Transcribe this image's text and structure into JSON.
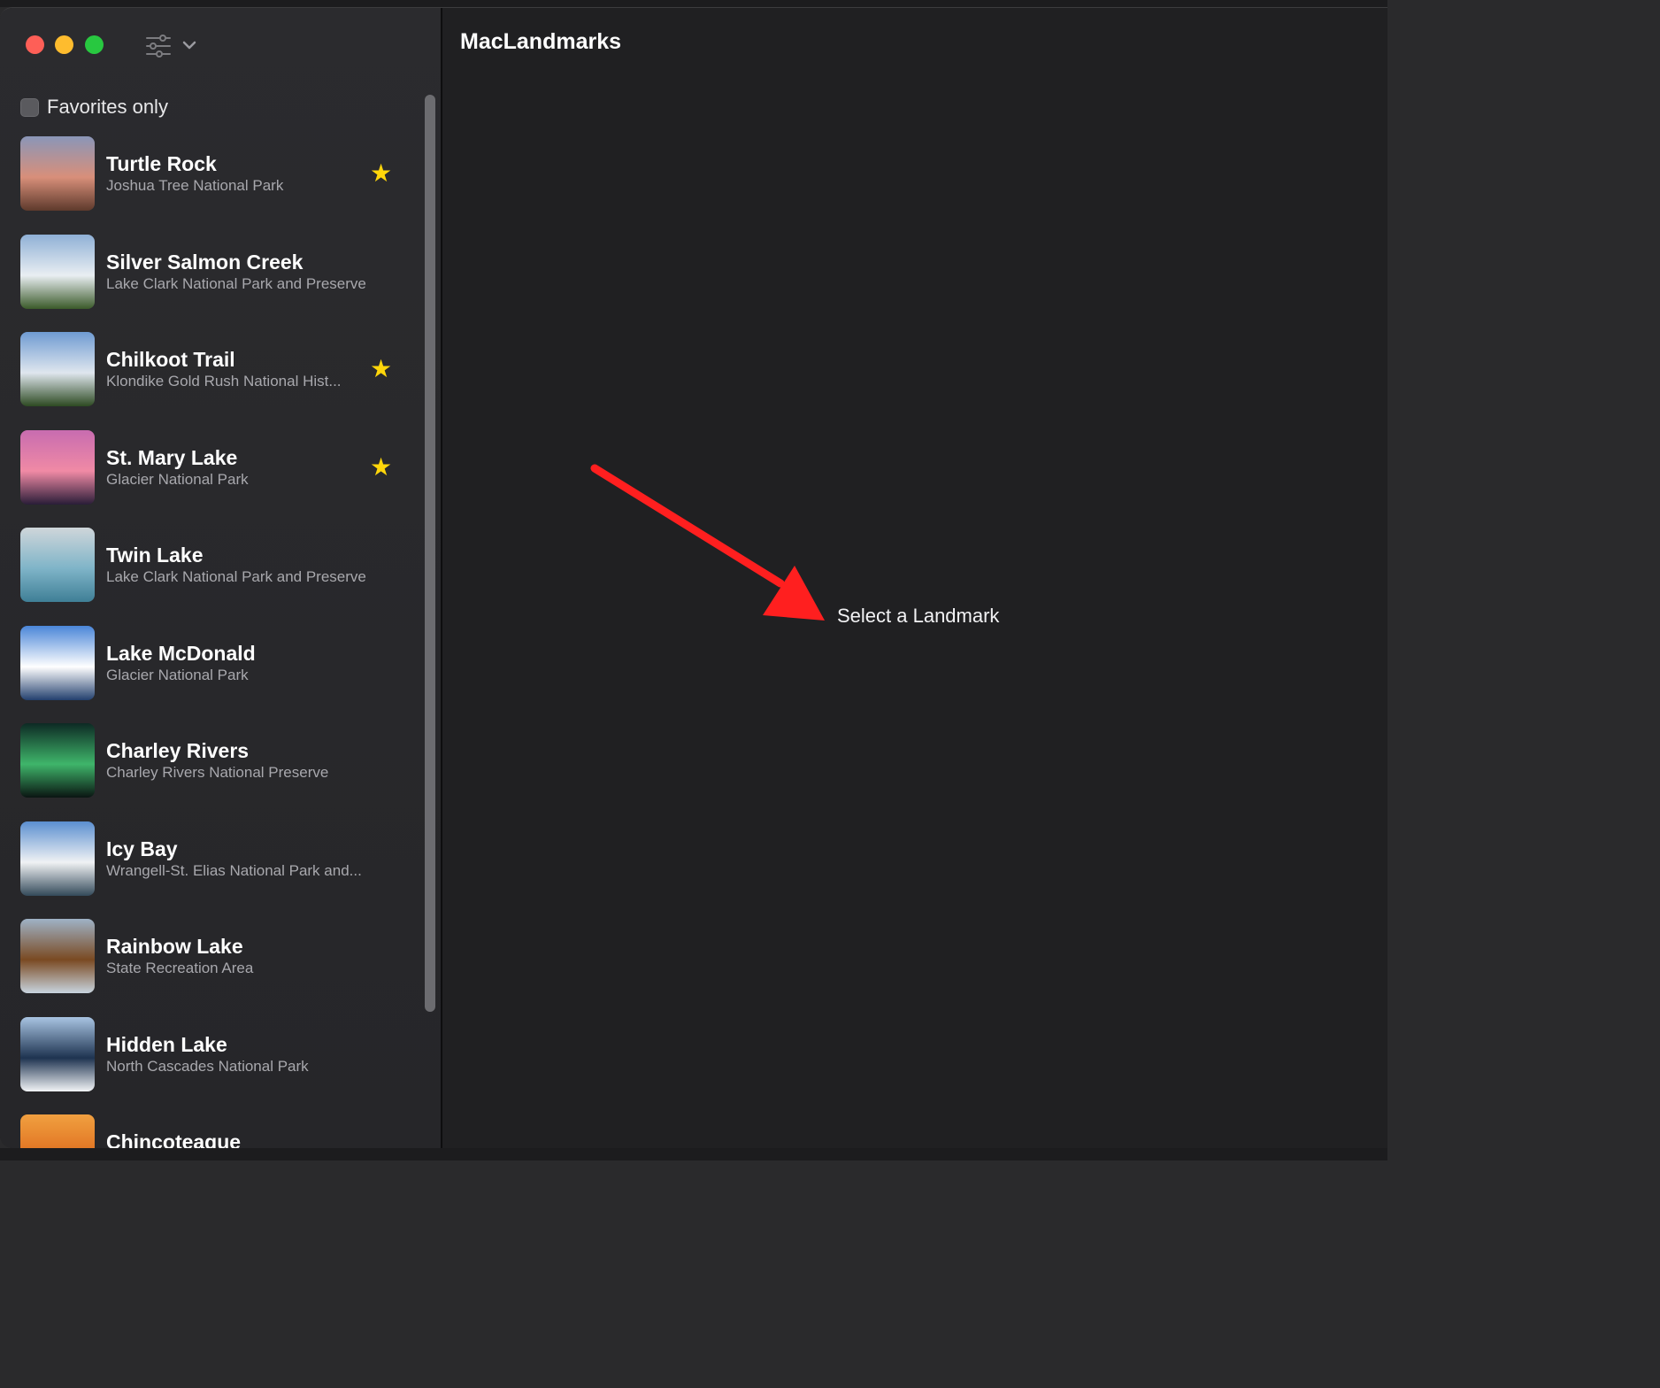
{
  "window": {
    "app_title": "MacLandmarks",
    "traffic_lights": {
      "close_color": "#fe5f57",
      "minimize_color": "#febc2e",
      "zoom_color": "#28c840"
    },
    "toolbar": {
      "filter_icon": "filter-sliders-icon",
      "chevron_icon": "chevron-down-icon"
    }
  },
  "sidebar": {
    "favorites_toggle": {
      "label": "Favorites only",
      "checked": false
    },
    "landmarks": [
      {
        "name": "Turtle Rock",
        "park": "Joshua Tree National Park",
        "favorite": true,
        "thumb": [
          "#8a96b8",
          "#d88f7a",
          "#5e3a2c"
        ]
      },
      {
        "name": "Silver Salmon Creek",
        "park": "Lake Clark National Park and Preserve",
        "favorite": false,
        "thumb": [
          "#8fb0d6",
          "#e9eef2",
          "#3b5a2a"
        ]
      },
      {
        "name": "Chilkoot Trail",
        "park": "Klondike Gold Rush National Hist...",
        "favorite": true,
        "thumb": [
          "#6f9bd2",
          "#dfe6ee",
          "#2d4a22"
        ]
      },
      {
        "name": "St. Mary Lake",
        "park": "Glacier National Park",
        "favorite": true,
        "thumb": [
          "#c86cb0",
          "#f08aa5",
          "#2a1d38"
        ]
      },
      {
        "name": "Twin Lake",
        "park": "Lake Clark National Park and Preserve",
        "favorite": false,
        "thumb": [
          "#cfd6da",
          "#7fb4c8",
          "#3f7f96"
        ]
      },
      {
        "name": "Lake McDonald",
        "park": "Glacier National Park",
        "favorite": false,
        "thumb": [
          "#4a86d8",
          "#ffffff",
          "#23406e"
        ]
      },
      {
        "name": "Charley Rivers",
        "park": "Charley Rivers National Preserve",
        "favorite": false,
        "thumb": [
          "#0d2a24",
          "#3fb56a",
          "#0a1512"
        ]
      },
      {
        "name": "Icy Bay",
        "park": "Wrangell-St. Elias National Park and...",
        "favorite": false,
        "thumb": [
          "#5b8fd0",
          "#f0f2f4",
          "#344a5a"
        ]
      },
      {
        "name": "Rainbow Lake",
        "park": "State Recreation Area",
        "favorite": false,
        "thumb": [
          "#9fb2c6",
          "#7a4a22",
          "#c8d4de"
        ]
      },
      {
        "name": "Hidden Lake",
        "park": "North Cascades National Park",
        "favorite": false,
        "thumb": [
          "#a8c4e2",
          "#1e3350",
          "#f2f4f6"
        ]
      },
      {
        "name": "Chincoteague",
        "park": "",
        "favorite": false,
        "thumb": [
          "#f0a040",
          "#e07020",
          "#b04a10"
        ]
      }
    ]
  },
  "detail": {
    "placeholder": "Select a Landmark",
    "annotation_arrow_color": "#ff1f1f"
  }
}
